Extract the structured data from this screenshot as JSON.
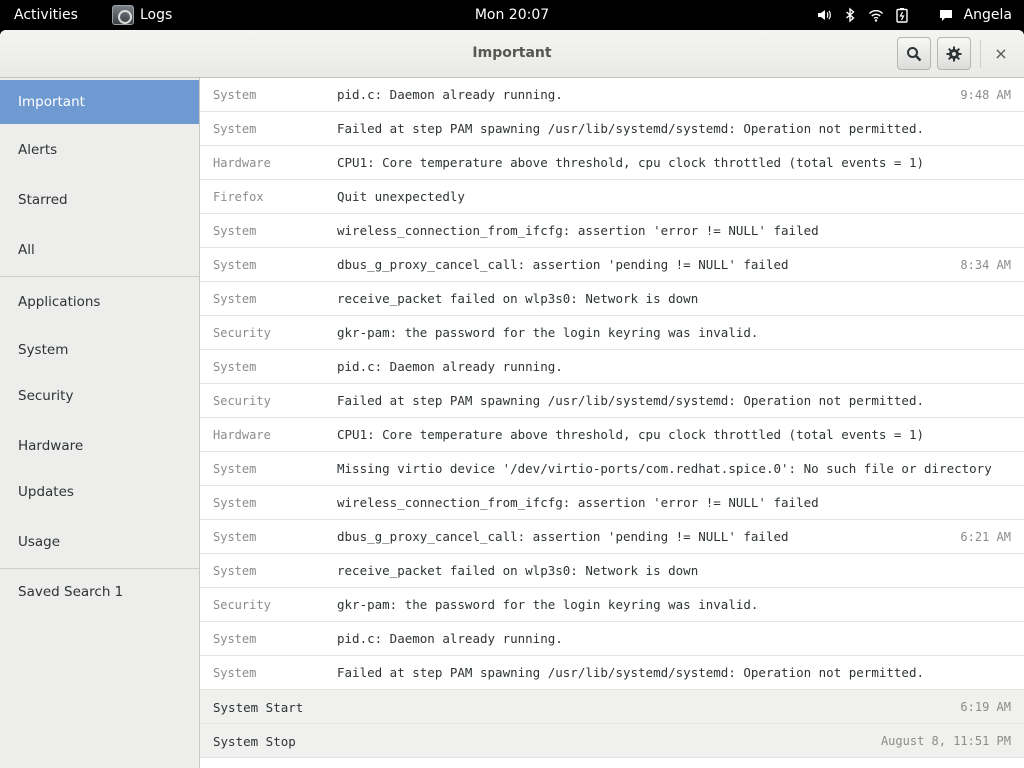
{
  "topbar": {
    "activities": "Activities",
    "app_name": "Logs",
    "clock": "Mon 20:07",
    "user": "Angela",
    "icons": [
      "volume-icon",
      "bluetooth-icon",
      "wifi-icon",
      "battery-icon",
      "chat-icon"
    ]
  },
  "window": {
    "title": "Important",
    "close_label": "×"
  },
  "sidebar": {
    "items": [
      {
        "label": "Important"
      },
      {
        "label": "Alerts"
      },
      {
        "label": "Starred"
      },
      {
        "label": "All"
      },
      {
        "label": "Applications"
      },
      {
        "label": "System"
      },
      {
        "label": "Security"
      },
      {
        "label": "Hardware"
      },
      {
        "label": "Updates"
      },
      {
        "label": "Usage"
      },
      {
        "label": "Saved Search 1"
      }
    ]
  },
  "rows": [
    {
      "category": "System",
      "message": "pid.c: Daemon already running.",
      "time": "9:48 AM"
    },
    {
      "category": "System",
      "message": "Failed at step PAM spawning /usr/lib/systemd/systemd: Operation not permitted.",
      "time": ""
    },
    {
      "category": "Hardware",
      "message": "CPU1: Core temperature above threshold, cpu clock throttled (total events = 1)",
      "time": ""
    },
    {
      "category": "Firefox",
      "message": "Quit unexpectedly",
      "time": ""
    },
    {
      "category": "System",
      "message": "wireless_connection_from_ifcfg: assertion 'error != NULL' failed",
      "time": ""
    },
    {
      "category": "System",
      "message": "dbus_g_proxy_cancel_call: assertion 'pending != NULL' failed",
      "time": "8:34 AM"
    },
    {
      "category": "System",
      "message": "receive_packet failed on wlp3s0: Network is down",
      "time": ""
    },
    {
      "category": "Security",
      "message": "gkr-pam: the password for the login keyring was invalid.",
      "time": ""
    },
    {
      "category": "System",
      "message": "pid.c: Daemon already running.",
      "time": ""
    },
    {
      "category": "Security",
      "message": "Failed at step PAM spawning /usr/lib/systemd/systemd: Operation not permitted.",
      "time": ""
    },
    {
      "category": "Hardware",
      "message": "CPU1: Core temperature above threshold, cpu clock throttled (total events = 1)",
      "time": ""
    },
    {
      "category": "System",
      "message": "Missing virtio device '/dev/virtio-ports/com.redhat.spice.0': No such file or directory",
      "time": ""
    },
    {
      "category": "System",
      "message": "wireless_connection_from_ifcfg: assertion 'error != NULL' failed",
      "time": ""
    },
    {
      "category": "System",
      "message": "dbus_g_proxy_cancel_call: assertion 'pending != NULL' failed",
      "time": "6:21 AM"
    },
    {
      "category": "System",
      "message": "receive_packet failed on wlp3s0: Network is down",
      "time": ""
    },
    {
      "category": "Security",
      "message": "gkr-pam: the password for the login keyring was invalid.",
      "time": ""
    },
    {
      "category": "System",
      "message": "pid.c: Daemon already running.",
      "time": ""
    },
    {
      "category": "System",
      "message": "Failed at step PAM spawning /usr/lib/systemd/systemd: Operation not permitted.",
      "time": ""
    }
  ],
  "boot_rows": [
    {
      "label": "System Start",
      "time": "6:19 AM"
    },
    {
      "label": "System Stop",
      "time": "August 8, 11:51 PM"
    }
  ],
  "colors": {
    "selected": "#6f9ad1",
    "sidebar_bg": "#ededec",
    "topbar_bg": "#000000"
  }
}
